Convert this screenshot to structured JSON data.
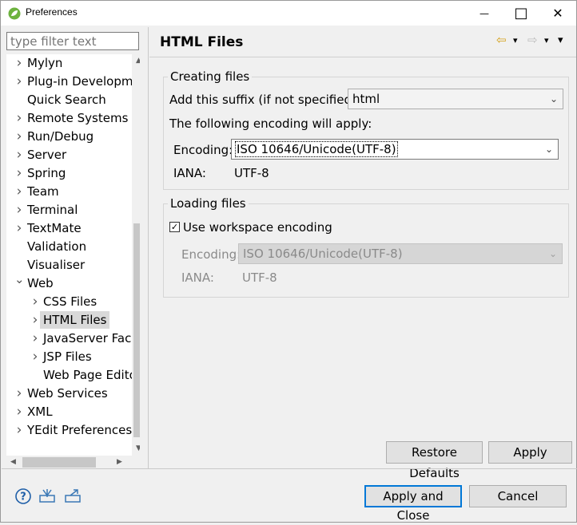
{
  "window": {
    "title": "Preferences",
    "minimize_icon": "—",
    "maximize_icon": "□",
    "close_icon": "✕"
  },
  "filter": {
    "placeholder": "type filter text"
  },
  "tree": {
    "items": [
      {
        "label": "Mylyn",
        "arrow": "›",
        "level": 0,
        "expandable": true
      },
      {
        "label": "Plug-in Developm",
        "arrow": "›",
        "level": 0,
        "expandable": true
      },
      {
        "label": "Quick Search",
        "arrow": "",
        "level": 0,
        "expandable": false
      },
      {
        "label": "Remote Systems",
        "arrow": "›",
        "level": 0,
        "expandable": true
      },
      {
        "label": "Run/Debug",
        "arrow": "›",
        "level": 0,
        "expandable": true
      },
      {
        "label": "Server",
        "arrow": "›",
        "level": 0,
        "expandable": true
      },
      {
        "label": "Spring",
        "arrow": "›",
        "level": 0,
        "expandable": true
      },
      {
        "label": "Team",
        "arrow": "›",
        "level": 0,
        "expandable": true
      },
      {
        "label": "Terminal",
        "arrow": "›",
        "level": 0,
        "expandable": true
      },
      {
        "label": "TextMate",
        "arrow": "›",
        "level": 0,
        "expandable": true
      },
      {
        "label": "Validation",
        "arrow": "",
        "level": 0,
        "expandable": false
      },
      {
        "label": "Visualiser",
        "arrow": "",
        "level": 0,
        "expandable": false
      },
      {
        "label": "Web",
        "arrow": "⌄",
        "level": 0,
        "expandable": true
      },
      {
        "label": "CSS Files",
        "arrow": "›",
        "level": 1,
        "expandable": true
      },
      {
        "label": "HTML Files",
        "arrow": "›",
        "level": 1,
        "expandable": true,
        "selected": true
      },
      {
        "label": "JavaServer Face",
        "arrow": "›",
        "level": 1,
        "expandable": true
      },
      {
        "label": "JSP Files",
        "arrow": "›",
        "level": 1,
        "expandable": true
      },
      {
        "label": "Web Page Edito",
        "arrow": "",
        "level": 1,
        "expandable": false
      },
      {
        "label": "Web Services",
        "arrow": "›",
        "level": 0,
        "expandable": true
      },
      {
        "label": "XML",
        "arrow": "›",
        "level": 0,
        "expandable": true
      },
      {
        "label": "YEdit Preferences",
        "arrow": "›",
        "level": 0,
        "expandable": true
      }
    ]
  },
  "page": {
    "title": "HTML Files",
    "nav_back_icon": "⇦",
    "nav_forward_icon": "⇨",
    "dropdown_icon": "▾"
  },
  "creating": {
    "legend": "Creating files",
    "suffix_label": "Add this suffix (if not specified):",
    "suffix_value": "html",
    "encoding_note": "The following encoding will apply:",
    "encoding_label": "Encoding:",
    "encoding_value": "ISO 10646/Unicode(UTF-8)",
    "iana_label": "IANA:",
    "iana_value": "UTF-8"
  },
  "loading": {
    "legend": "Loading files",
    "use_workspace_label": "Use workspace encoding",
    "use_workspace_checked": true,
    "encoding_label": "Encoding:",
    "encoding_value": "ISO 10646/Unicode(UTF-8)",
    "iana_label": "IANA:",
    "iana_value": "UTF-8"
  },
  "buttons": {
    "restore_defaults": "Restore Defaults",
    "apply": "Apply",
    "apply_and_close": "Apply and Close",
    "cancel": "Cancel"
  },
  "colors": {
    "accent": "#0078d7",
    "selection": "#d9d9d9"
  }
}
